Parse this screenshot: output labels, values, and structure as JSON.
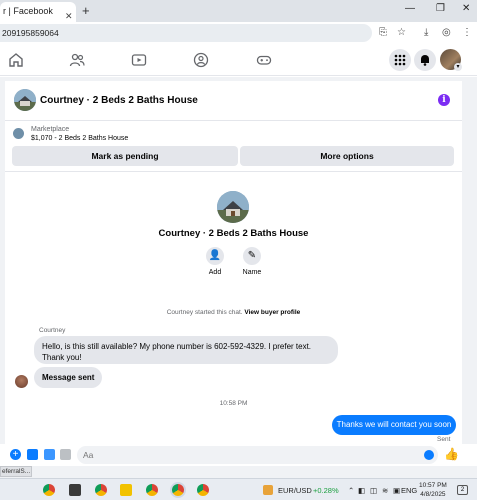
{
  "browser": {
    "tab_title": "r | Facebook",
    "url": "209195859064"
  },
  "conversation": {
    "title": "Courtney · 2 Beds 2 Baths House",
    "marketplace_label": "Marketplace",
    "listing": "$1,070 - 2 Beds 2 Baths House",
    "buttons": {
      "pending": "Mark as pending",
      "more": "More options"
    },
    "profile_name": "Courtney · 2 Beds 2 Baths House",
    "actions": {
      "add": "Add",
      "name": "Name"
    },
    "started_text": "Courtney started this chat.",
    "view_profile": "View buyer profile",
    "sender": "Courtney",
    "message1": "Hello, is this still available?  My phone number is 602-592-4329.  I prefer text.  Thank you!",
    "message2": "Message sent",
    "timestamp": "10:58 PM",
    "reply": "Thanks we will contact you soon",
    "sent": "Sent"
  },
  "composer": {
    "placeholder": "Aa"
  },
  "status_bar": {
    "text": "eferralS..."
  },
  "taskbar": {
    "ticker": "EUR/USD",
    "change": "+0.28%",
    "lang": "ENG",
    "time": "10:57 PM",
    "date": "4/8/2025",
    "notif_count": "2"
  },
  "colors": {
    "messenger_blue": "#0a7cff",
    "info_purple": "#7b2cf3",
    "ticker_green": "#1a9e3f"
  }
}
